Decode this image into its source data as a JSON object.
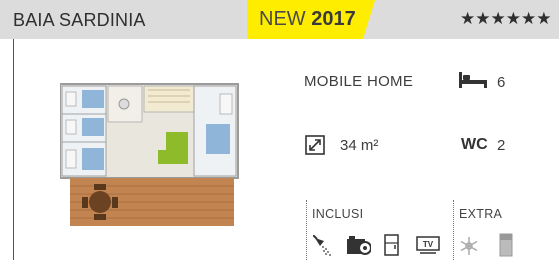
{
  "header": {
    "location": "BAIA SARDINIA",
    "badge_new": "NEW",
    "badge_year": "2017",
    "stars": "★★★★★★"
  },
  "specs": {
    "type_label": "MOBILE HOME",
    "beds": "6",
    "area_value": "34 m²",
    "wc_label": "WC",
    "wc_count": "2"
  },
  "amenities": {
    "included_label": "INCLUSI",
    "included_icons": [
      "shower-icon",
      "camera-icon",
      "fridge-icon",
      "tv-icon"
    ],
    "extra_label": "EXTRA",
    "extra_icons": [
      "air-conditioning-icon",
      "bed-linen-icon"
    ]
  },
  "colors": {
    "header_bg": "#dcdcdc",
    "badge_yellow": "#ffed00",
    "deck_wood": "#c28450",
    "accent_green": "#8dbb2a"
  }
}
